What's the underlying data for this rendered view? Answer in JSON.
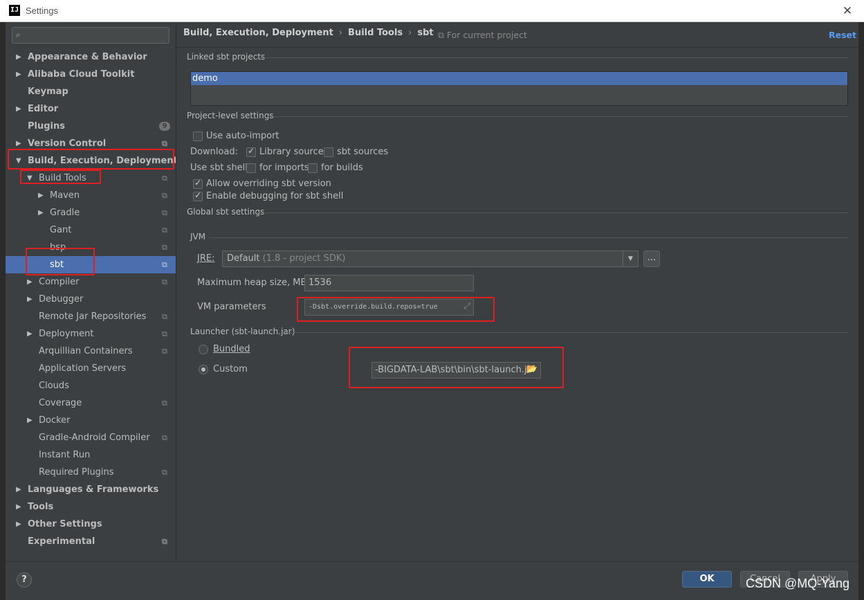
{
  "window": {
    "title": "Settings",
    "logo": "IJ"
  },
  "sidebar": {
    "search_placeholder": "",
    "items": [
      {
        "label": "Appearance & Behavior",
        "expanded": false
      },
      {
        "label": "Alibaba Cloud Toolkit",
        "expanded": false
      },
      {
        "label": "Keymap"
      },
      {
        "label": "Editor",
        "expanded": false
      },
      {
        "label": "Plugins",
        "badge": "9"
      },
      {
        "label": "Version Control",
        "expanded": false
      },
      {
        "label": "Build, Execution, Deployment",
        "expanded": true
      },
      {
        "label": "Build Tools",
        "expanded": true
      },
      {
        "label": "Maven",
        "expanded": false
      },
      {
        "label": "Gradle",
        "expanded": false
      },
      {
        "label": "Gant"
      },
      {
        "label": "bsp"
      },
      {
        "label": "sbt",
        "selected": true
      },
      {
        "label": "Compiler",
        "expanded": false
      },
      {
        "label": "Debugger",
        "expanded": false
      },
      {
        "label": "Remote Jar Repositories"
      },
      {
        "label": "Deployment",
        "expanded": false
      },
      {
        "label": "Arquillian Containers"
      },
      {
        "label": "Application Servers"
      },
      {
        "label": "Clouds"
      },
      {
        "label": "Coverage"
      },
      {
        "label": "Docker",
        "expanded": false
      },
      {
        "label": "Gradle-Android Compiler"
      },
      {
        "label": "Instant Run"
      },
      {
        "label": "Required Plugins"
      },
      {
        "label": "Languages & Frameworks",
        "expanded": false
      },
      {
        "label": "Tools",
        "expanded": false
      },
      {
        "label": "Other Settings",
        "expanded": false
      },
      {
        "label": "Experimental"
      }
    ]
  },
  "header": {
    "breadcrumb": [
      "Build, Execution, Deployment",
      "Build Tools",
      "sbt"
    ],
    "for_current_project": "For current project",
    "reset": "Reset"
  },
  "linked": {
    "section_title": "Linked sbt projects",
    "projects": [
      "demo"
    ]
  },
  "project_level": {
    "section_title": "Project-level settings",
    "use_auto_import": {
      "label": "Use auto-import",
      "checked": false
    },
    "download_label": "Download:",
    "library_sources": {
      "label": "Library sources",
      "checked": true
    },
    "sbt_sources": {
      "label": "sbt sources",
      "checked": false
    },
    "use_sbt_shell_label": "Use sbt shell:",
    "for_imports": {
      "label": "for imports",
      "checked": false
    },
    "for_builds": {
      "label": "for builds",
      "checked": false
    },
    "allow_overriding": {
      "label": "Allow overriding sbt version",
      "checked": true
    },
    "enable_debugging": {
      "label": "Enable debugging for sbt shell",
      "checked": true
    }
  },
  "global": {
    "section_title": "Global sbt settings",
    "jvm_title": "JVM",
    "jre_label": "JRE:",
    "jre_value": "Default",
    "jre_value_detail": "(1.8 - project SDK)",
    "ellipsis": "...",
    "heap_label": "Maximum heap size, MB",
    "heap_value": "1536",
    "vm_label": "VM parameters",
    "vm_value": "-Dsbt.override.build.repos=true",
    "launcher_title": "Launcher (sbt-launch.jar)",
    "bundled_label": "Bundled",
    "custom_label": "Custom",
    "custom_path": "-BIGDATA-LAB\\sbt\\bin\\sbt-launch.jar",
    "launcher_selected": "Custom"
  },
  "footer": {
    "help": "?",
    "ok": "OK",
    "cancel": "Cancel",
    "apply": "Apply"
  },
  "watermark": "CSDN @MQ-Yang",
  "colors": {
    "selection": "#4b6eaf",
    "panel": "#3c3f41",
    "link": "#589df6",
    "highlight_box": "#e02020"
  },
  "icons": [
    "intellij-logo-icon",
    "close-icon",
    "search-icon",
    "expand-arrow-icon",
    "project-scope-icon",
    "dropdown-arrow-icon",
    "expand-field-icon",
    "folder-open-icon",
    "help-icon"
  ]
}
